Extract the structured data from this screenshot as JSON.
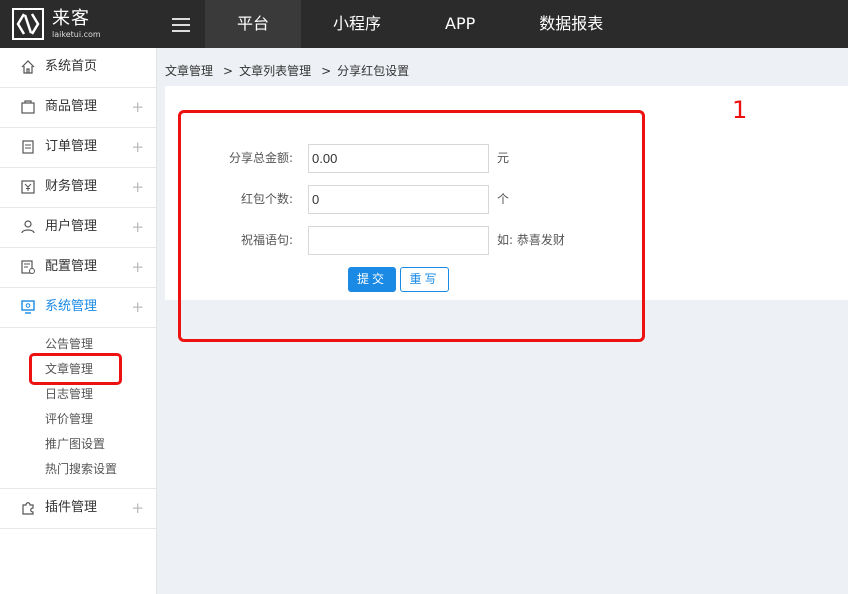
{
  "logo": {
    "main": "来客",
    "sub": "laiketui.com"
  },
  "topnav": [
    "平台",
    "小程序",
    "APP",
    "数据报表"
  ],
  "sidebar": {
    "items": [
      {
        "label": "系统首页",
        "icon": "home-icon"
      },
      {
        "label": "商品管理",
        "icon": "shop-icon"
      },
      {
        "label": "订单管理",
        "icon": "clipboard-icon"
      },
      {
        "label": "财务管理",
        "icon": "finance-icon"
      },
      {
        "label": "用户管理",
        "icon": "user-icon"
      },
      {
        "label": "配置管理",
        "icon": "config-icon"
      },
      {
        "label": "系统管理",
        "icon": "monitor-icon"
      },
      {
        "label": "插件管理",
        "icon": "puzzle-icon"
      }
    ],
    "submenu": [
      "公告管理",
      "文章管理",
      "日志管理",
      "评价管理",
      "推广图设置",
      "热门搜索设置"
    ],
    "plus": "+"
  },
  "breadcrumb": {
    "level1": "文章管理",
    "level2": "文章列表管理",
    "level3": "分享红包设置",
    "sep": ">"
  },
  "form": {
    "total_label": "分享总金额:",
    "total_value": "0.00",
    "total_suffix": "元",
    "count_label": "红包个数:",
    "count_value": "0",
    "count_suffix": "个",
    "wish_label": "祝福语句:",
    "wish_value": "",
    "wish_suffix": "如: 恭喜发财",
    "submit_label": "提交",
    "reset_label": "重写"
  },
  "annotation": {
    "number": "1",
    "color": "#ee1111"
  },
  "colors": {
    "accent": "#1a8ae5",
    "topbar": "#2b2b2b"
  }
}
